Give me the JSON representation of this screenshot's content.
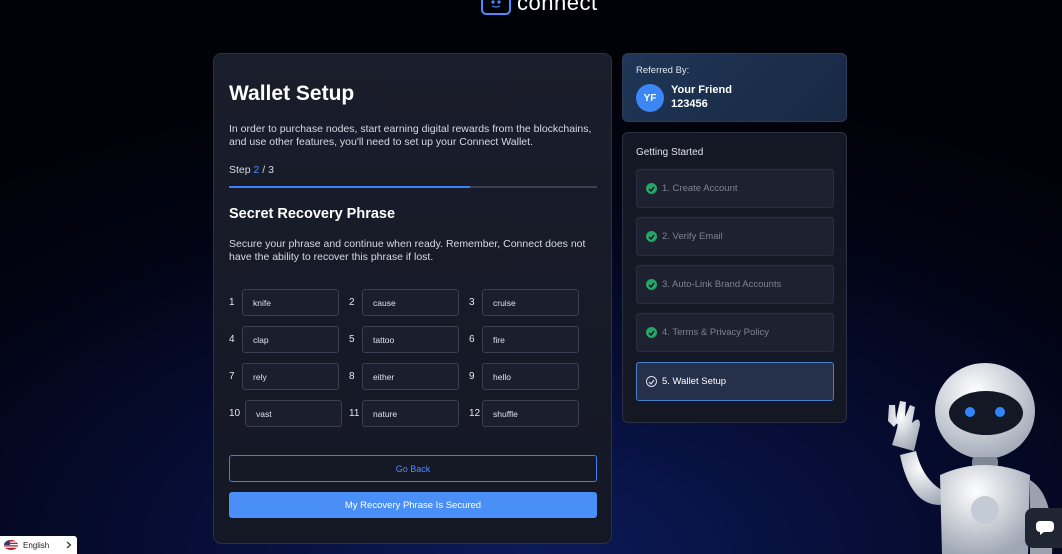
{
  "brand": {
    "name": "connect"
  },
  "wallet": {
    "title": "Wallet Setup",
    "intro": "In order to purchase nodes, start earning digital rewards from the blockchains, and use other features, you'll need to set up your Connect Wallet.",
    "step_prefix": "Step ",
    "step_current": "2",
    "step_sep": " / ",
    "step_total": "3",
    "progress_fraction": 0.656,
    "phrase_title": "Secret Recovery Phrase",
    "phrase_instructions": "Secure your phrase and continue when ready. Remember, Connect does not have the ability to recover this phrase if lost.",
    "words": [
      {
        "n": "1",
        "w": "knife"
      },
      {
        "n": "2",
        "w": "cause"
      },
      {
        "n": "3",
        "w": "cruise"
      },
      {
        "n": "4",
        "w": "clap"
      },
      {
        "n": "5",
        "w": "tattoo"
      },
      {
        "n": "6",
        "w": "fire"
      },
      {
        "n": "7",
        "w": "rely"
      },
      {
        "n": "8",
        "w": "either"
      },
      {
        "n": "9",
        "w": "hello"
      },
      {
        "n": "10",
        "w": "vast"
      },
      {
        "n": "11",
        "w": "nature"
      },
      {
        "n": "12",
        "w": "shuffle"
      }
    ],
    "go_back": "Go Back",
    "secured": "My Recovery Phrase Is Secured"
  },
  "referral": {
    "label": "Referred By:",
    "initials": "YF",
    "name": "Your Friend",
    "code": "123456"
  },
  "getting_started": {
    "label": "Getting Started",
    "steps": [
      {
        "label": "1. Create Account",
        "status": "done"
      },
      {
        "label": "2. Verify Email",
        "status": "done"
      },
      {
        "label": "3. Auto-Link Brand Accounts",
        "status": "done"
      },
      {
        "label": "4. Terms & Privacy Policy",
        "status": "done"
      },
      {
        "label": "5. Wallet Setup",
        "status": "active"
      }
    ]
  },
  "language": {
    "label": "English"
  },
  "colors": {
    "accent": "#4a8ff7",
    "check": "#27a36b",
    "background": "#060c30"
  }
}
